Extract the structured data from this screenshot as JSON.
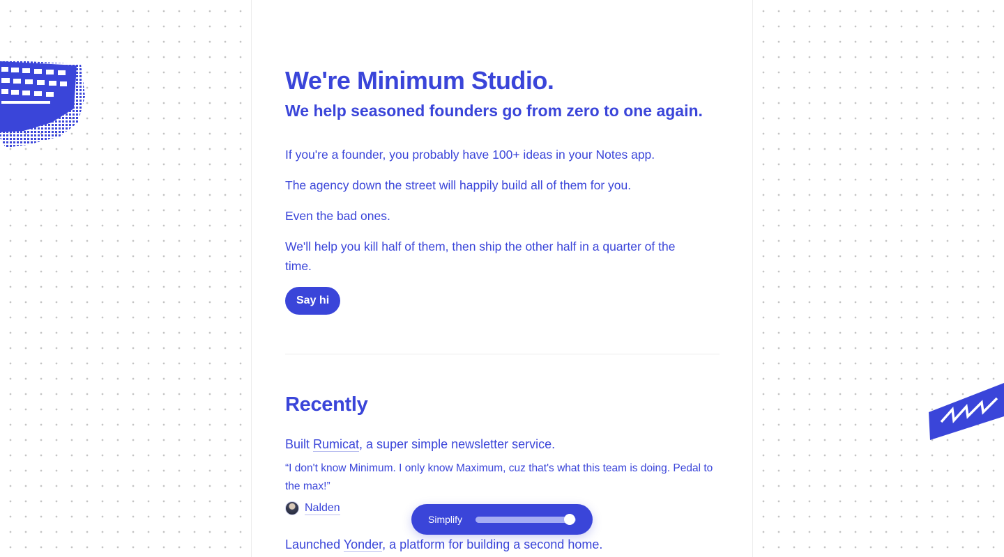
{
  "brand": {
    "accent": "#3a45d9",
    "background": "#ffffff"
  },
  "hero": {
    "title": "We're Minimum Studio.",
    "subtitle": "We help seasoned founders go from zero to one again.",
    "paragraphs": [
      "If you're a founder, you probably have 100+ ideas in your Notes app.",
      "The agency down the street will happily build all of them for you.",
      "Even the bad ones.",
      "We'll help you kill half of them, then ship the other half in a quarter of the time."
    ],
    "cta_label": "Say hi"
  },
  "recently": {
    "title": "Recently",
    "items": [
      {
        "prefix": "Built ",
        "link": "Rumicat",
        "suffix": ", a super simple newsletter service.",
        "quote": "“I don't know Minimum. I only know Maximum, cuz that's what this team is doing. Pedal to the max!”",
        "author": "Nalden"
      },
      {
        "prefix": "Launched ",
        "link": "Yonder",
        "suffix": ", a platform for building a second home."
      }
    ]
  },
  "simplify_control": {
    "label": "Simplify",
    "value_fraction": 0.94
  },
  "decorations": {
    "left_art_icon": "pixel-keyboard-icon",
    "right_art_icon": "zigzag-stroke-icon"
  }
}
